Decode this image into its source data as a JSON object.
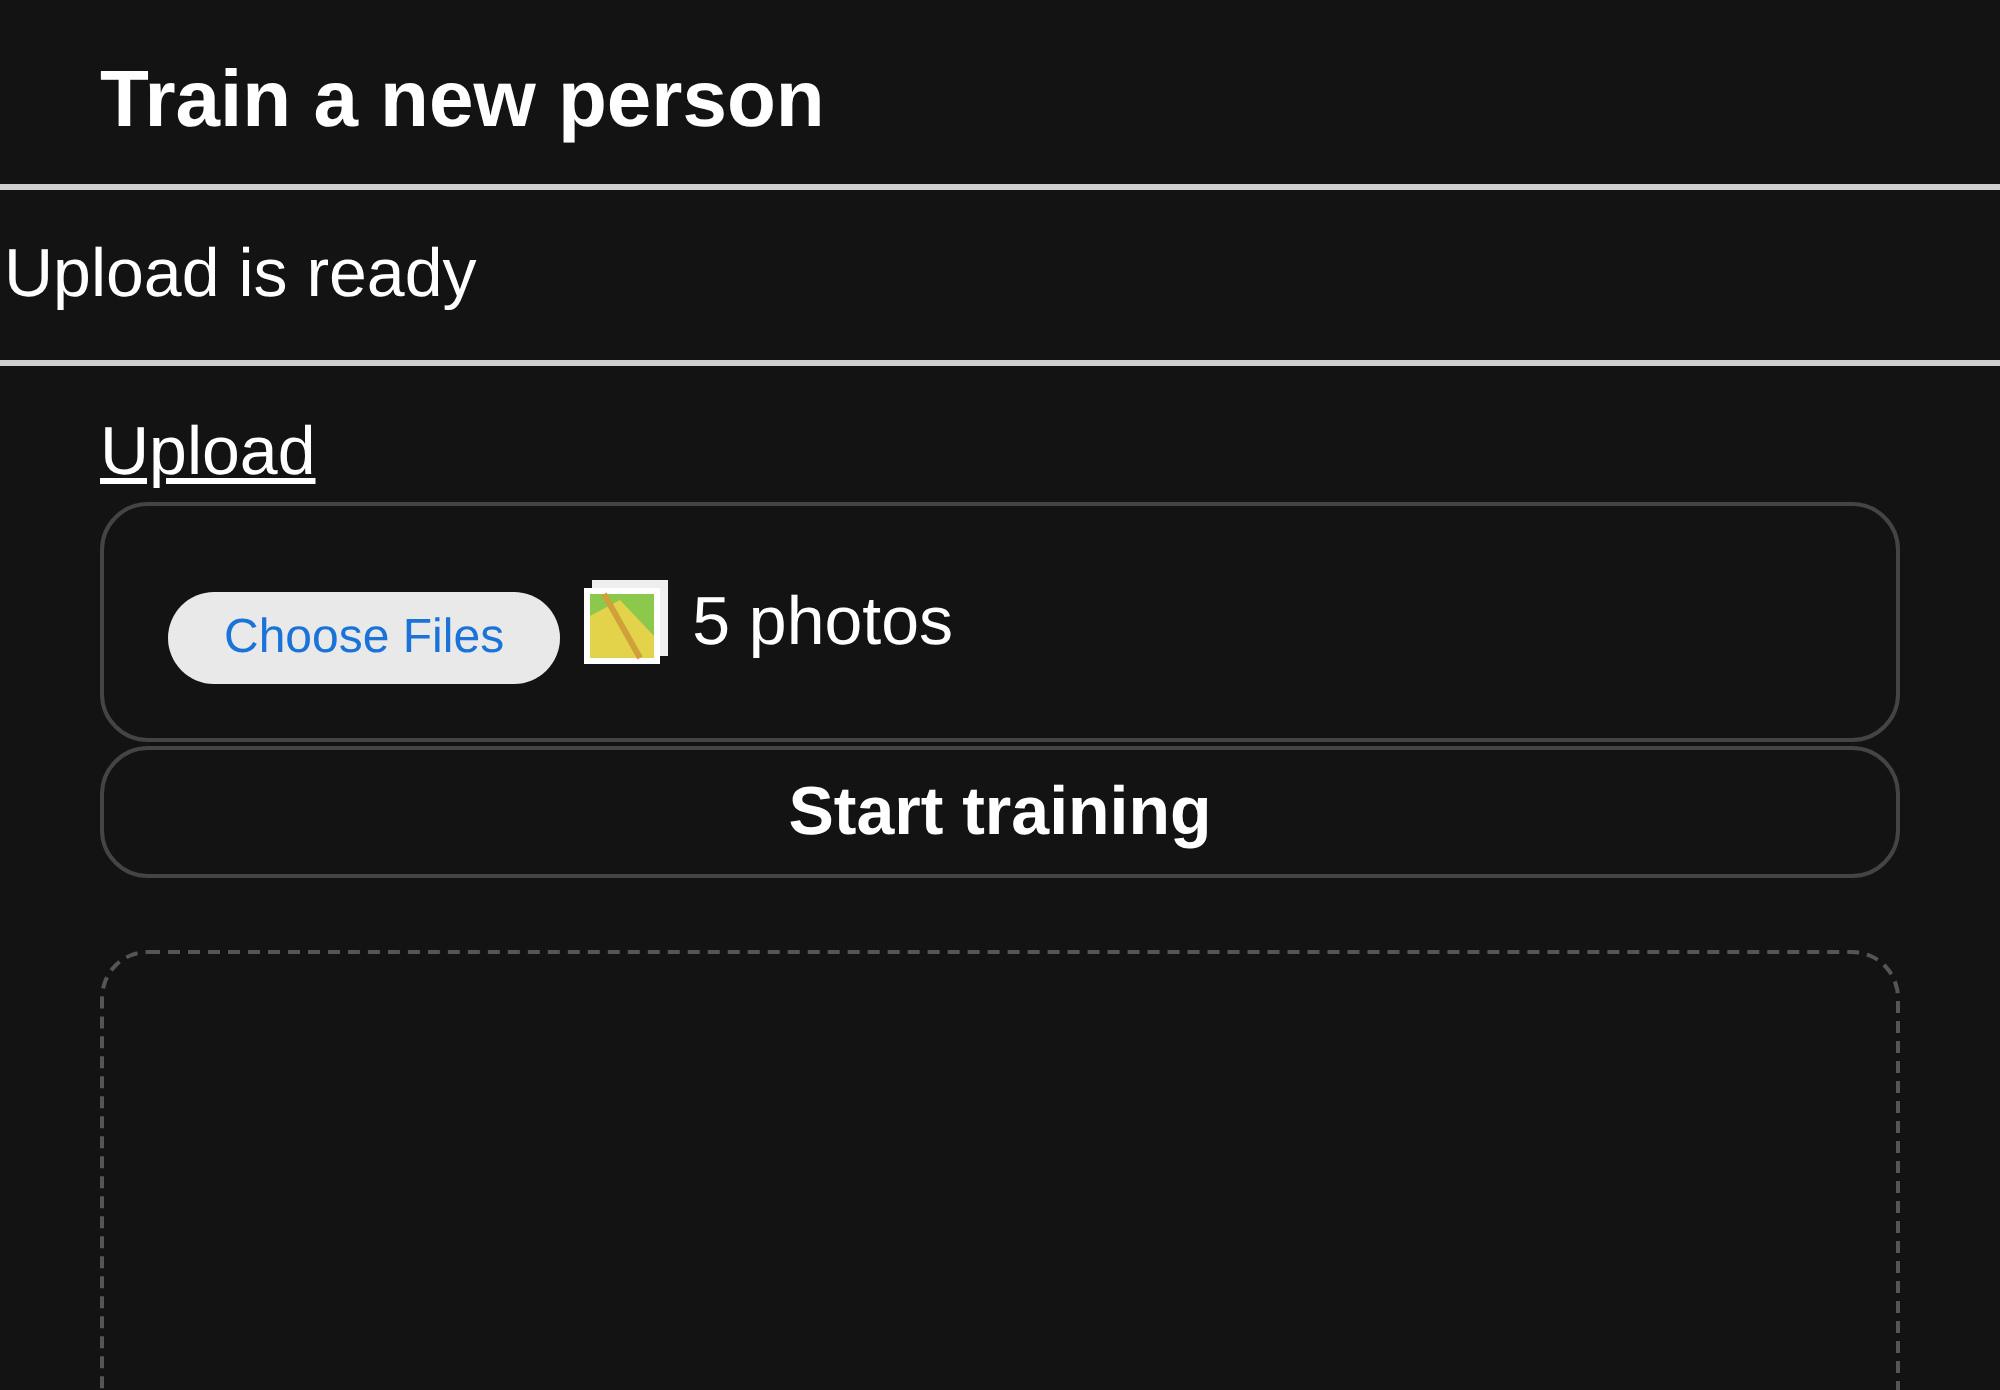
{
  "title": "Train a new person",
  "status": "Upload is ready",
  "upload": {
    "link": "Upload",
    "button": "Choose Files",
    "file_summary": "5 photos"
  },
  "start_button": "Start training"
}
